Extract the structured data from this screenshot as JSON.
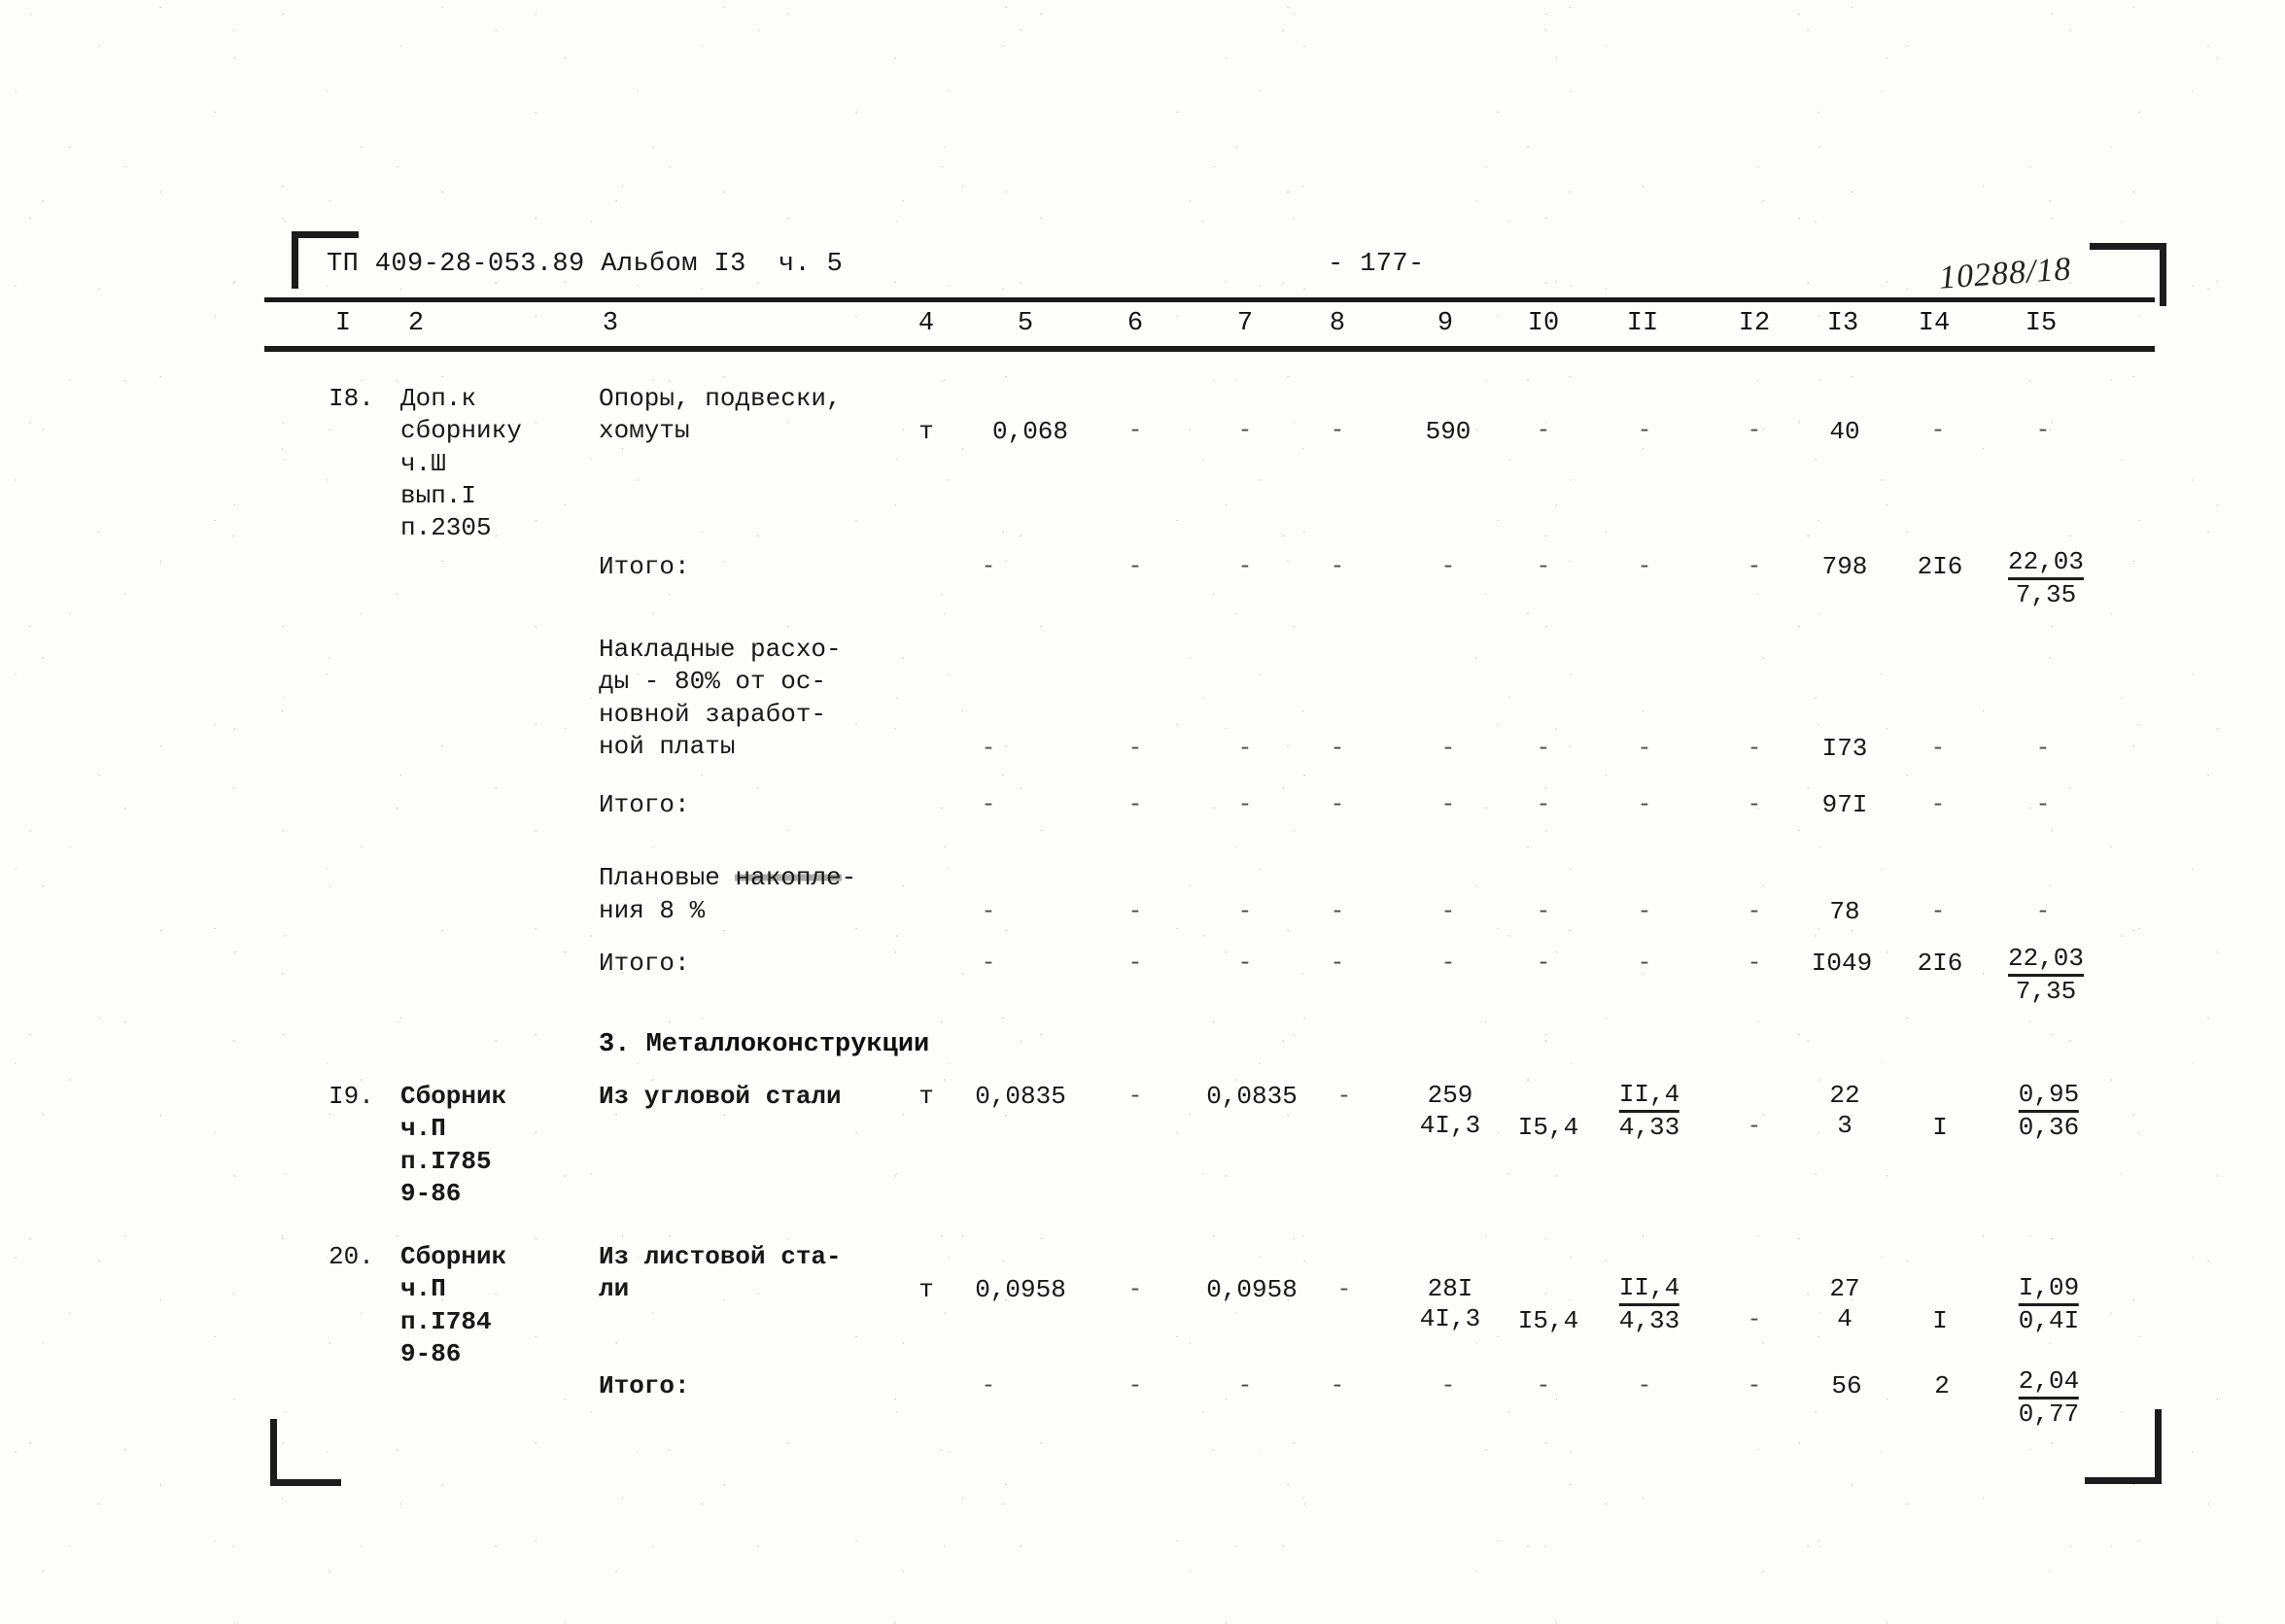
{
  "document": {
    "header_code": "ТП 409-28-053.89 Альбом I3  ч. 5",
    "page_number": "- 177-",
    "stamp_number": "10288/18"
  },
  "table": {
    "column_numbers": [
      "I",
      "2",
      "3",
      "4",
      "5",
      "6",
      "7",
      "8",
      "9",
      "I0",
      "II",
      "I2",
      "I3",
      "I4",
      "I5"
    ],
    "rows": [
      {
        "id": "row-18",
        "num": "I8.",
        "ref": "Доп.к\nсборнику\nч.Ш\nвып.I\nп.2305",
        "name": "Опоры, подвески,\nхомуты",
        "unit": "т",
        "c5": "0,068",
        "c6": "-",
        "c7": "-",
        "c8": "-",
        "c9": "590",
        "c10": "-",
        "c11": "-",
        "c12": "-",
        "c13": "40",
        "c14": "-",
        "c15": "-"
      },
      {
        "id": "row-itogo-1",
        "label": "Итого:",
        "c5": "-",
        "c6": "-",
        "c7": "-",
        "c8": "-",
        "c9": "-",
        "c10": "-",
        "c11": "-",
        "c12": "-",
        "c13": "798",
        "c14": "2I6",
        "c15_num": "22,03",
        "c15_den": "7,35"
      },
      {
        "id": "row-overhead",
        "label": "Накладные расхо-\nды - 80% от ос-\nновной заработ-\nной платы",
        "c5": "-",
        "c6": "-",
        "c7": "-",
        "c8": "-",
        "c9": "-",
        "c10": "-",
        "c11": "-",
        "c12": "-",
        "c13": "I73",
        "c14": "-",
        "c15": "-"
      },
      {
        "id": "row-itogo-2",
        "label": "Итого:",
        "c5": "-",
        "c6": "-",
        "c7": "-",
        "c8": "-",
        "c9": "-",
        "c10": "-",
        "c11": "-",
        "c12": "-",
        "c13": "97I",
        "c14": "-",
        "c15": "-"
      },
      {
        "id": "row-profit",
        "label_a": "Плановые ",
        "label_b": "накопле",
        "label_c": "-",
        "label_d": "ния 8 %",
        "c5": "-",
        "c6": "-",
        "c7": "-",
        "c8": "-",
        "c9": "-",
        "c10": "-",
        "c11": "-",
        "c12": "-",
        "c13": "78",
        "c14": "-",
        "c15": "-"
      },
      {
        "id": "row-itogo-3",
        "label": "Итого:",
        "c5": "-",
        "c6": "-",
        "c7": "-",
        "c8": "-",
        "c9": "-",
        "c10": "-",
        "c11": "-",
        "c12": "-",
        "c13": "I049",
        "c14": "2I6",
        "c15_num": "22,03",
        "c15_den": "7,35"
      }
    ],
    "section_heading": "3. Металлоконструкции",
    "metal_rows": [
      {
        "id": "row-19",
        "num": "I9.",
        "ref": "Сборник\nч.П\nп.I785\n9-86",
        "name": "Из угловой стали",
        "unit": "т",
        "c5": "0,0835",
        "c6": "-",
        "c7": "0,0835",
        "c8": "-",
        "c9_num": "259",
        "c9_den": "4I,3",
        "c10": "I5,4",
        "c11_num": "II,4",
        "c11_den": "4,33",
        "c12": "-",
        "c13_num": "22",
        "c13_den": "3",
        "c14": "I",
        "c15_num": "0,95",
        "c15_den": "0,36"
      },
      {
        "id": "row-20",
        "num": "20.",
        "ref": "Сборник\nч.П\nп.I784\n9-86",
        "name": "Из листовой ста-\nли",
        "unit": "т",
        "c5": "0,0958",
        "c6": "-",
        "c7": "0,0958",
        "c8": "-",
        "c9_num": "28I",
        "c9_den": "4I,3",
        "c10": "I5,4",
        "c11_num": "II,4",
        "c11_den": "4,33",
        "c12": "-",
        "c13_num": "27",
        "c13_den": "4",
        "c14": "I",
        "c15_num": "I,09",
        "c15_den": "0,4I"
      }
    ],
    "final_total": {
      "id": "row-itogo-final",
      "label": "Итого:",
      "c5": "-",
      "c6": "-",
      "c7": "-",
      "c8": "-",
      "c9": "-",
      "c10": "-",
      "c11": "-",
      "c12": "-",
      "c13": "56",
      "c14": "2",
      "c15_num": "2,04",
      "c15_den": "0,77"
    }
  }
}
